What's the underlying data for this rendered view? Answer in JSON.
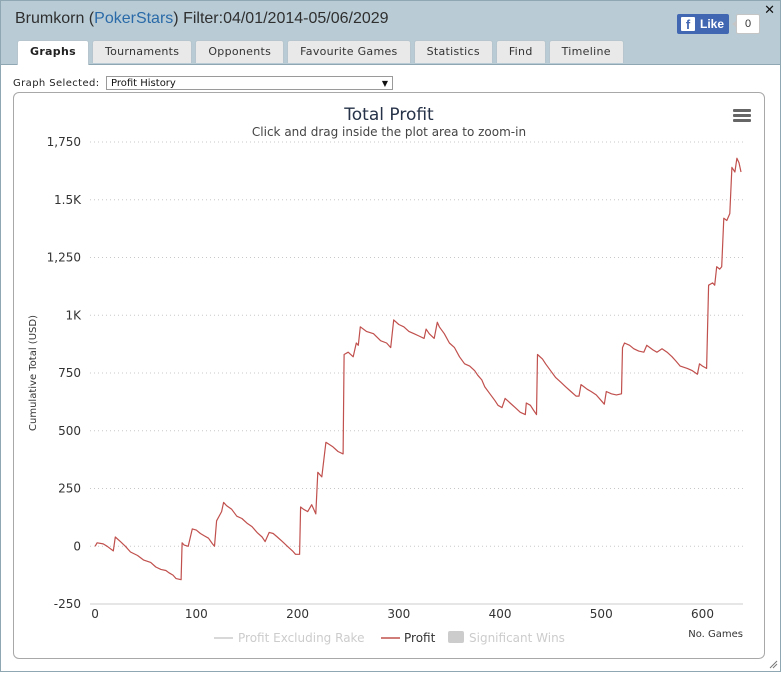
{
  "window": {
    "player": "Brumkorn",
    "site": "PokerStars",
    "filter": "Filter:04/01/2014-05/06/2029",
    "close_label": "✕"
  },
  "facebook": {
    "like_label": "Like",
    "like_count": "0"
  },
  "tabs": [
    {
      "label": "Graphs",
      "active": true
    },
    {
      "label": "Tournaments"
    },
    {
      "label": "Opponents"
    },
    {
      "label": "Favourite Games"
    },
    {
      "label": "Statistics"
    },
    {
      "label": "Find"
    },
    {
      "label": "Timeline"
    }
  ],
  "graph_selector": {
    "label": "Graph Selected:",
    "value": "Profit History"
  },
  "chart_data": {
    "type": "line",
    "title": "Total Profit",
    "subtitle": "Click and drag inside the plot area to zoom-in",
    "ylabel": "Cumulative Total (USD)",
    "xlabel": "No. Games",
    "xlim": [
      -5,
      640
    ],
    "ylim": [
      -250,
      1750
    ],
    "x_ticks": [
      "0",
      "100",
      "200",
      "300",
      "400",
      "500",
      "600"
    ],
    "y_ticks": [
      "-250",
      "0",
      "250",
      "500",
      "750",
      "1K",
      "1,250",
      "1.5K",
      "1,750"
    ],
    "grid": true,
    "legend_position": "bottom",
    "legend": [
      {
        "name": "Profit Excluding Rake",
        "color": "#cccccc",
        "kind": "line"
      },
      {
        "name": "Profit",
        "color": "#c0504d",
        "kind": "line"
      },
      {
        "name": "Significant Wins",
        "color": "#cccccc",
        "kind": "box"
      }
    ],
    "series": [
      {
        "name": "Profit",
        "color": "#c0504d",
        "points": [
          [
            0,
            0
          ],
          [
            2,
            15
          ],
          [
            8,
            10
          ],
          [
            12,
            0
          ],
          [
            18,
            -20
          ],
          [
            20,
            40
          ],
          [
            25,
            20
          ],
          [
            30,
            0
          ],
          [
            35,
            -25
          ],
          [
            42,
            -40
          ],
          [
            48,
            -60
          ],
          [
            55,
            -70
          ],
          [
            60,
            -90
          ],
          [
            65,
            -100
          ],
          [
            70,
            -105
          ],
          [
            73,
            -115
          ],
          [
            77,
            -125
          ],
          [
            80,
            -140
          ],
          [
            85,
            -145
          ],
          [
            86,
            15
          ],
          [
            88,
            5
          ],
          [
            92,
            0
          ],
          [
            96,
            75
          ],
          [
            100,
            70
          ],
          [
            104,
            55
          ],
          [
            108,
            45
          ],
          [
            112,
            35
          ],
          [
            116,
            10
          ],
          [
            118,
            0
          ],
          [
            120,
            110
          ],
          [
            125,
            150
          ],
          [
            127,
            190
          ],
          [
            130,
            175
          ],
          [
            135,
            160
          ],
          [
            140,
            130
          ],
          [
            145,
            120
          ],
          [
            150,
            100
          ],
          [
            155,
            85
          ],
          [
            160,
            60
          ],
          [
            165,
            40
          ],
          [
            168,
            20
          ],
          [
            172,
            60
          ],
          [
            176,
            55
          ],
          [
            180,
            40
          ],
          [
            185,
            20
          ],
          [
            190,
            0
          ],
          [
            195,
            -20
          ],
          [
            198,
            -35
          ],
          [
            202,
            -35
          ],
          [
            203,
            170
          ],
          [
            206,
            160
          ],
          [
            210,
            150
          ],
          [
            214,
            180
          ],
          [
            218,
            140
          ],
          [
            220,
            320
          ],
          [
            224,
            300
          ],
          [
            228,
            450
          ],
          [
            235,
            430
          ],
          [
            240,
            410
          ],
          [
            245,
            400
          ],
          [
            246,
            830
          ],
          [
            250,
            840
          ],
          [
            255,
            820
          ],
          [
            258,
            880
          ],
          [
            260,
            870
          ],
          [
            262,
            950
          ],
          [
            268,
            930
          ],
          [
            275,
            920
          ],
          [
            282,
            890
          ],
          [
            288,
            880
          ],
          [
            292,
            860
          ],
          [
            295,
            980
          ],
          [
            300,
            960
          ],
          [
            305,
            950
          ],
          [
            310,
            930
          ],
          [
            315,
            920
          ],
          [
            320,
            910
          ],
          [
            325,
            900
          ],
          [
            327,
            940
          ],
          [
            330,
            920
          ],
          [
            335,
            900
          ],
          [
            338,
            970
          ],
          [
            340,
            950
          ],
          [
            345,
            920
          ],
          [
            350,
            880
          ],
          [
            355,
            860
          ],
          [
            360,
            820
          ],
          [
            365,
            790
          ],
          [
            370,
            780
          ],
          [
            375,
            760
          ],
          [
            378,
            740
          ],
          [
            382,
            720
          ],
          [
            385,
            690
          ],
          [
            390,
            660
          ],
          [
            395,
            630
          ],
          [
            398,
            610
          ],
          [
            402,
            600
          ],
          [
            405,
            640
          ],
          [
            410,
            620
          ],
          [
            415,
            600
          ],
          [
            420,
            580
          ],
          [
            425,
            570
          ],
          [
            426,
            620
          ],
          [
            430,
            610
          ],
          [
            433,
            590
          ],
          [
            436,
            570
          ],
          [
            437,
            830
          ],
          [
            442,
            810
          ],
          [
            445,
            790
          ],
          [
            450,
            760
          ],
          [
            455,
            730
          ],
          [
            460,
            710
          ],
          [
            465,
            690
          ],
          [
            470,
            670
          ],
          [
            475,
            650
          ],
          [
            478,
            650
          ],
          [
            480,
            700
          ],
          [
            483,
            690
          ],
          [
            486,
            680
          ],
          [
            490,
            670
          ],
          [
            495,
            655
          ],
          [
            500,
            630
          ],
          [
            503,
            615
          ],
          [
            505,
            670
          ],
          [
            510,
            660
          ],
          [
            515,
            655
          ],
          [
            520,
            660
          ],
          [
            521,
            860
          ],
          [
            523,
            880
          ],
          [
            528,
            870
          ],
          [
            532,
            855
          ],
          [
            537,
            845
          ],
          [
            542,
            840
          ],
          [
            545,
            870
          ],
          [
            548,
            860
          ],
          [
            551,
            850
          ],
          [
            555,
            840
          ],
          [
            560,
            855
          ],
          [
            565,
            840
          ],
          [
            570,
            820
          ],
          [
            574,
            800
          ],
          [
            578,
            780
          ],
          [
            585,
            770
          ],
          [
            590,
            760
          ],
          [
            595,
            745
          ],
          [
            597,
            790
          ],
          [
            600,
            780
          ],
          [
            604,
            770
          ],
          [
            606,
            1130
          ],
          [
            610,
            1140
          ],
          [
            612,
            1130
          ],
          [
            614,
            1210
          ],
          [
            617,
            1200
          ],
          [
            619,
            1210
          ],
          [
            621,
            1420
          ],
          [
            624,
            1410
          ],
          [
            627,
            1440
          ],
          [
            629,
            1640
          ],
          [
            632,
            1620
          ],
          [
            634,
            1680
          ],
          [
            636,
            1660
          ],
          [
            638,
            1620
          ]
        ]
      }
    ]
  }
}
